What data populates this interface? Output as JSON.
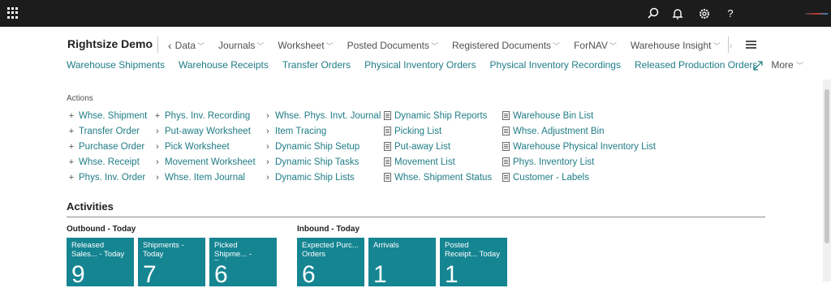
{
  "topbar": {
    "icons": [
      "waffle-icon",
      "search-icon",
      "bell-icon",
      "gear-icon",
      "help-icon"
    ],
    "help_label": "?",
    "background": "#1c1c1c"
  },
  "header": {
    "company": "Rightsize Demo",
    "menu": [
      {
        "label": "Data"
      },
      {
        "label": "Journals"
      },
      {
        "label": "Worksheet"
      },
      {
        "label": "Posted Documents"
      },
      {
        "label": "Registered Documents"
      },
      {
        "label": "ForNAV"
      },
      {
        "label": "Warehouse Insight"
      }
    ],
    "navlinks": [
      "Warehouse Shipments",
      "Warehouse Receipts",
      "Transfer Orders",
      "Physical Inventory Orders",
      "Physical Inventory Recordings",
      "Released Production Orders"
    ],
    "more_label": "More"
  },
  "actions": {
    "title": "Actions",
    "columns": [
      {
        "icon": "plus-icon",
        "items": [
          "Whse. Shipment",
          "Transfer Order",
          "Purchase Order",
          "Whse. Receipt",
          "Phys. Inv. Order"
        ]
      },
      {
        "icon": "mixed",
        "items": [
          "Phys. Inv. Recording",
          "Put-away Worksheet",
          "Pick Worksheet",
          "Movement Worksheet",
          "Whse. Item Journal"
        ]
      },
      {
        "icon": "chevron-right-icon",
        "items": [
          "Whse. Phys. Invt. Journal",
          "Item Tracing",
          "Dynamic Ship Setup",
          "Dynamic Ship Tasks",
          "Dynamic Ship Lists"
        ]
      },
      {
        "icon": "document-icon",
        "items": [
          "Dynamic Ship Reports",
          "Picking List",
          "Put-away List",
          "Movement List",
          "Whse. Shipment Status"
        ]
      },
      {
        "icon": "document-icon",
        "items": [
          "Warehouse Bin List",
          "Whse. Adjustment Bin",
          "Warehouse Physical Inventory List",
          "Phys. Inventory List",
          "Customer - Labels"
        ]
      }
    ]
  },
  "activities": {
    "title": "Activities",
    "groups": [
      {
        "title": "Outbound - Today",
        "tiles": [
          {
            "label": "Released Sales... - Today",
            "value": "9"
          },
          {
            "label": "Shipments - Today",
            "value": "7"
          },
          {
            "label": "Picked Shipme... - Today",
            "value": "6"
          }
        ]
      },
      {
        "title": "Inbound - Today",
        "tiles": [
          {
            "label": "Expected Purc... Orders",
            "value": "6"
          },
          {
            "label": "Arrivals",
            "value": "1"
          },
          {
            "label": "Posted Receipt... Today",
            "value": "1"
          }
        ]
      }
    ],
    "tile_color": "#158592"
  },
  "colors": {
    "accent": "#1f7c86",
    "text": "#212121"
  }
}
